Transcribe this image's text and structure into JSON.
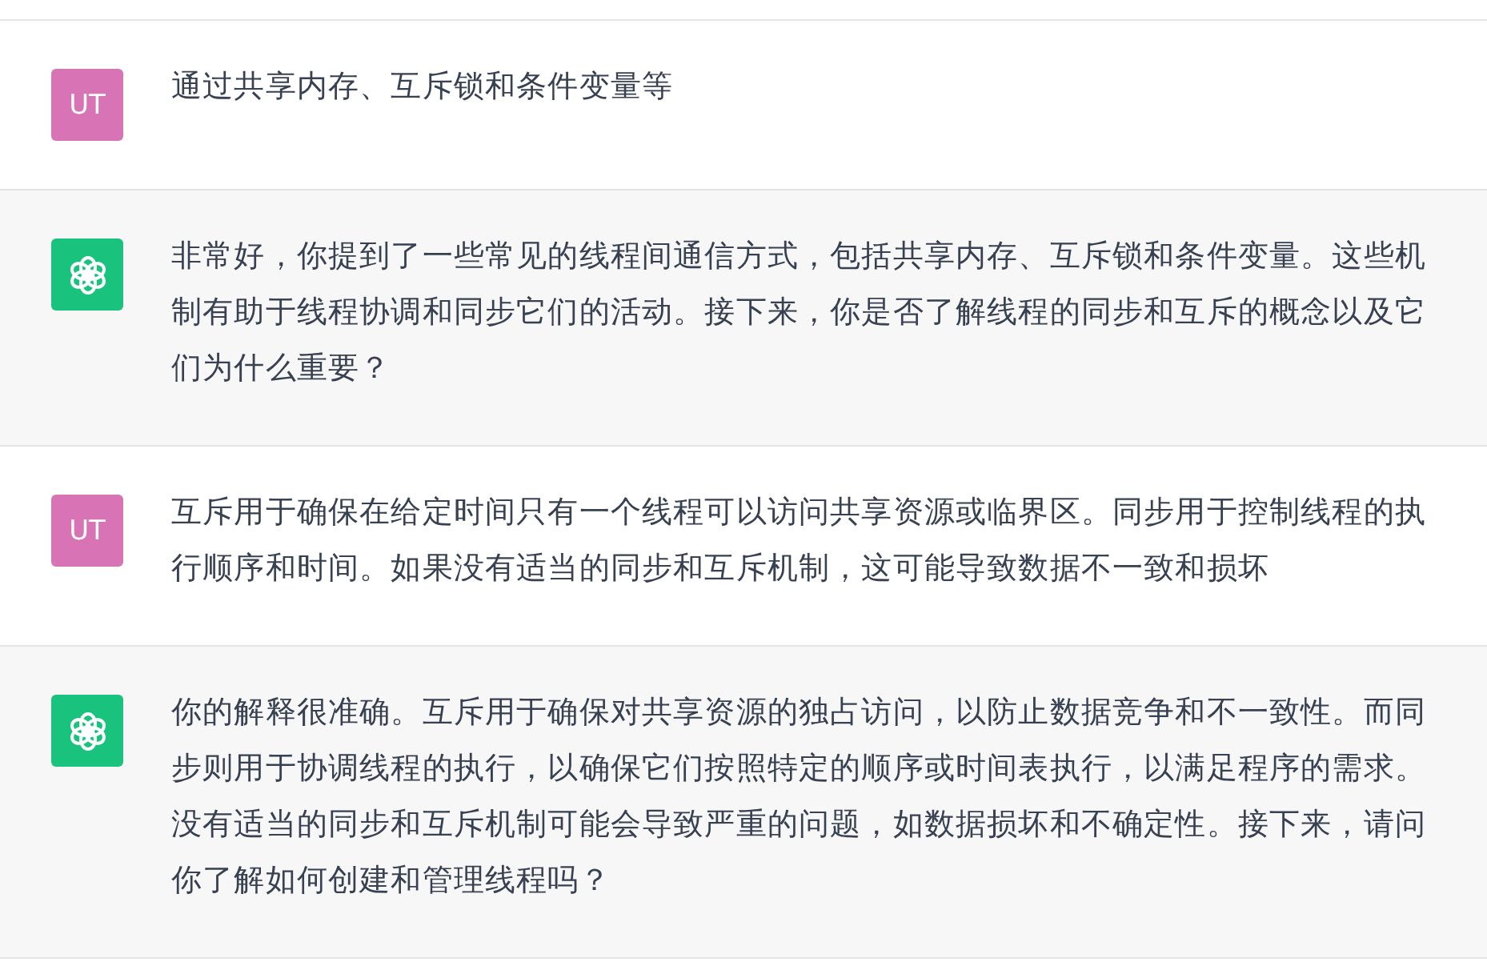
{
  "messages": [
    {
      "kind": "user",
      "avatar": "UT",
      "text": "通过共享内存、互斥锁和条件变量等"
    },
    {
      "kind": "assistant",
      "text": "非常好，你提到了一些常见的线程间通信方式，包括共享内存、互斥锁和条件变量。这些机制有助于线程协调和同步它们的活动。接下来，你是否了解线程的同步和互斥的概念以及它们为什么重要？"
    },
    {
      "kind": "user",
      "avatar": "UT",
      "text": "互斥用于确保在给定时间只有一个线程可以访问共享资源或临界区。同步用于控制线程的执行顺序和时间。如果没有适当的同步和互斥机制，这可能导致数据不一致和损坏"
    },
    {
      "kind": "assistant",
      "text": "你的解释很准确。互斥用于确保对共享资源的独占访问，以防止数据竞争和不一致性。而同步则用于协调线程的执行，以确保它们按照特定的顺序或时间表执行，以满足程序的需求。没有适当的同步和互斥机制可能会导致严重的问题，如数据损坏和不确定性。接下来，请问你了解如何创建和管理线程吗？"
    }
  ]
}
